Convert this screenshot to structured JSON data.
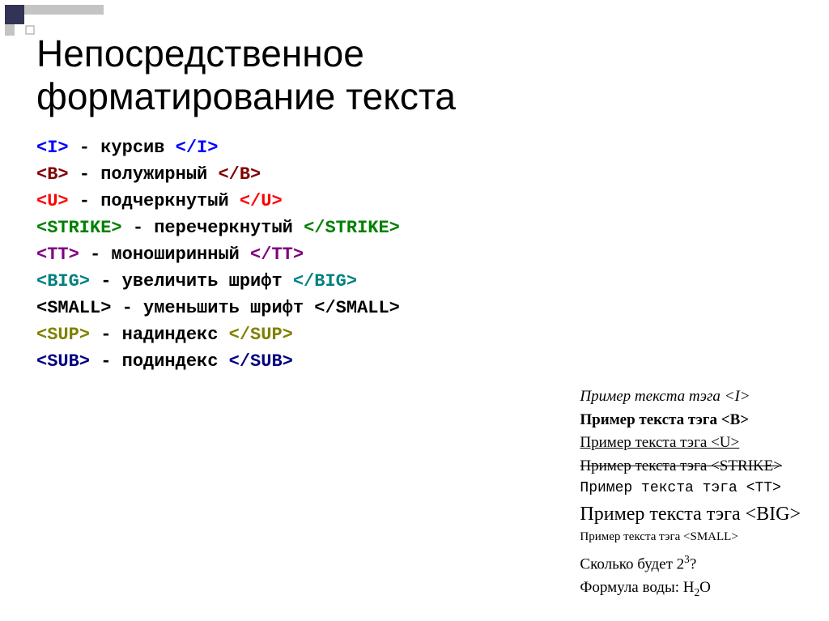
{
  "title_line1": "Непосредственное",
  "title_line2": "форматирование текста",
  "tags": [
    {
      "open": "<I>",
      "desc": " - курсив ",
      "close": "</I>",
      "colorClass": "color-i"
    },
    {
      "open": "<B>",
      "desc": " - полужирный ",
      "close": "</B>",
      "colorClass": "color-b"
    },
    {
      "open": "<U>",
      "desc": " - подчеркнутый ",
      "close": "</U>",
      "colorClass": "color-u"
    },
    {
      "open": "<STRIKE>",
      "desc": " - перечеркнутый ",
      "close": "</STRIKE>",
      "colorClass": "color-strike"
    },
    {
      "open": "<TT>",
      "desc": " - моноширинный ",
      "close": "</TT>",
      "colorClass": "color-tt"
    },
    {
      "open": "<BIG>",
      "desc": " - увеличить шрифт ",
      "close": "</BIG>",
      "colorClass": "color-big"
    },
    {
      "open": "<SMALL>",
      "desc": " - уменьшить шрифт ",
      "close": "</SMALL>",
      "colorClass": "color-small"
    },
    {
      "open": "<SUP>",
      "desc": " - надиндекс ",
      "close": "</SUP>",
      "colorClass": "color-sup"
    },
    {
      "open": "<SUB>",
      "desc": " - подиндекс ",
      "close": "</SUB>",
      "colorClass": "color-sub"
    }
  ],
  "examples": {
    "prefix": "Пример текста тэга ",
    "i_tag": "<I>",
    "b_tag": "<B>",
    "u_tag": "<U>",
    "strike_tag": "<STRIKE>",
    "tt_tag": "<TT>",
    "big_tag": "<BIG>",
    "small_tag": "<SMALL>",
    "sup_question_before": "Сколько будет 2",
    "sup_exponent": "3",
    "sup_question_after": "?",
    "sub_formula_before": "Формула воды: H",
    "sub_subscript": "2",
    "sub_formula_after": "O"
  }
}
